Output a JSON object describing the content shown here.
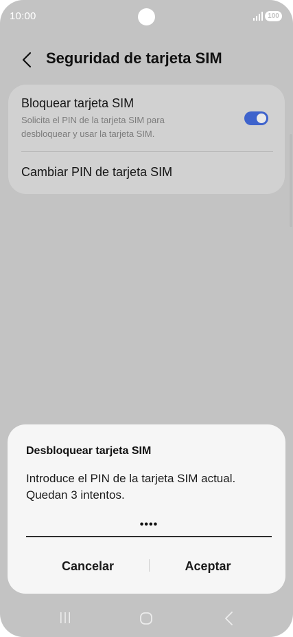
{
  "status_bar": {
    "time": "10:00",
    "battery": "100",
    "signal_icon": "signal-icon"
  },
  "header": {
    "title": "Seguridad de tarjeta SIM",
    "back_icon": "back-arrow-icon"
  },
  "settings": {
    "lock_sim": {
      "title": "Bloquear tarjeta SIM",
      "description": "Solicita el PIN de la tarjeta SIM para desbloquear y usar la tarjeta SIM.",
      "enabled": true
    },
    "change_pin": {
      "title": "Cambiar PIN de tarjeta SIM"
    }
  },
  "dialog": {
    "title": "Desbloquear tarjeta SIM",
    "message": "Introduce el PIN de la tarjeta SIM actual. Quedan 3 intentos.",
    "pin_value": "••••",
    "cancel_label": "Cancelar",
    "ok_label": "Aceptar"
  },
  "nav_bar": {
    "recent_icon": "recent-apps-icon",
    "home_icon": "home-icon",
    "back_icon": "back-icon"
  },
  "colors": {
    "toggle_on": "#3e63cc",
    "scrim": "#c3c3c3",
    "dialog_bg": "#f6f6f6"
  }
}
